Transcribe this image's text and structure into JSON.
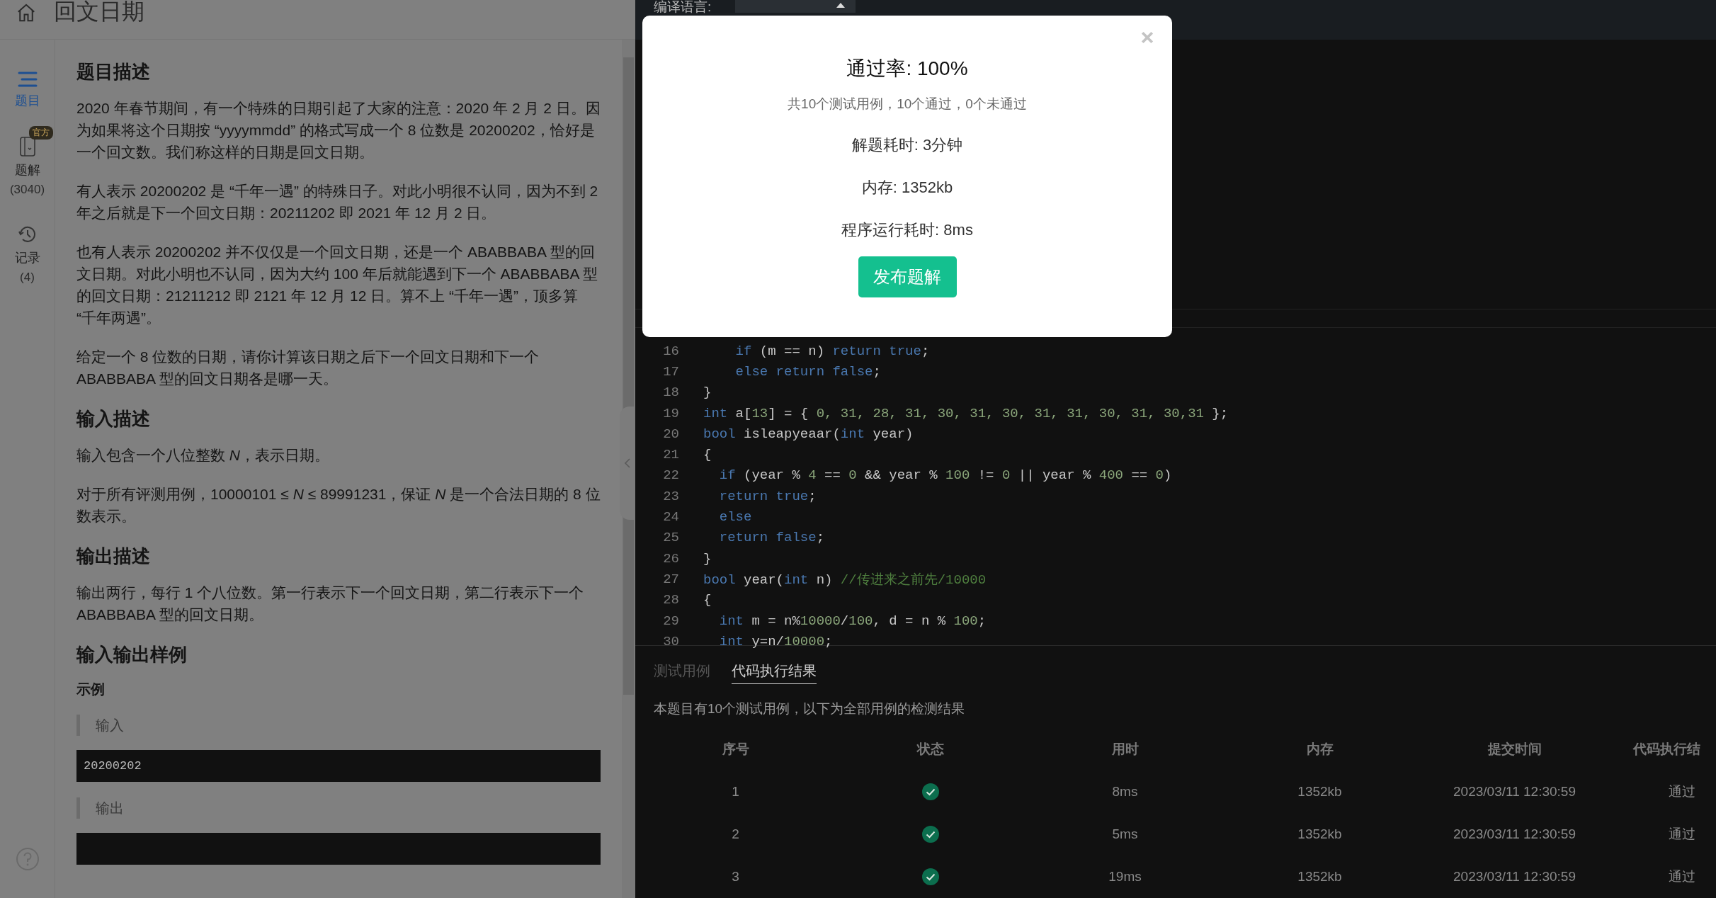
{
  "header": {
    "title": "回文日期"
  },
  "sidebar": {
    "items": [
      {
        "kind": "list",
        "label": "题目",
        "selected": true
      },
      {
        "kind": "book",
        "label": "题解",
        "badge": "官方",
        "count": "(3040)",
        "selected": false
      },
      {
        "kind": "history",
        "label": "记录",
        "count": "(4)",
        "selected": false
      }
    ]
  },
  "problem": {
    "sections": [
      {
        "heading": "题目描述",
        "paragraphs": [
          "2020 年春节期间，有一个特殊的日期引起了大家的注意：2020 年 2 月 2 日。因为如果将这个日期按 “yyyymmdd” 的格式写成一个 8 位数是 20200202，恰好是一个回文数。我们称这样的日期是回文日期。",
          "有人表示 20200202 是 “千年一遇” 的特殊日子。对此小明很不认同，因为不到 2 年之后就是下一个回文日期：20211202 即 2021 年 12 月 2 日。",
          "也有人表示 20200202 并不仅仅是一个回文日期，还是一个 ABABBABA 型的回文日期。对此小明也不认同，因为大约 100 年后就能遇到下一个 ABABBABA 型的回文日期：21211212 即 2121 年 12 月 12 日。算不上 “千年一遇”，顶多算 “千年两遇”。",
          "给定一个 8 位数的日期，请你计算该日期之后下一个回文日期和下一个 ABABBABA 型的回文日期各是哪一天。"
        ]
      },
      {
        "heading": "输入描述",
        "paragraphs": [
          "输入包含一个八位整数 *N*，表示日期。",
          "对于所有评测用例，10000101 ≤ *N* ≤ 89991231，保证 *N* 是一个合法日期的 8 位数表示。"
        ]
      },
      {
        "heading": "输出描述",
        "paragraphs": [
          "输出两行，每行 1 个八位数。第一行表示下一个回文日期，第二行表示下一个 ABABBABA 型的回文日期。"
        ]
      }
    ],
    "samples": {
      "heading": "输入输出样例",
      "example_title": "示例",
      "input_label": "输入",
      "input": "20200202",
      "output_label": "输出"
    }
  },
  "editor": {
    "language_label": "编译语言:",
    "lines": [
      {
        "number": "16",
        "tokens": [
          {
            "text": "    if",
            "kind": "keyword"
          },
          {
            "text": " (m == n)",
            "kind": "plain"
          },
          {
            "text": " return true",
            "kind": "keyword"
          },
          {
            "text": ";",
            "kind": "plain"
          }
        ]
      },
      {
        "number": "17",
        "tokens": [
          {
            "text": "    else return false",
            "kind": "keyword"
          },
          {
            "text": ";",
            "kind": "plain"
          }
        ]
      },
      {
        "number": "18",
        "tokens": [
          {
            "text": "}",
            "kind": "plain"
          }
        ]
      },
      {
        "number": "19",
        "tokens": [
          {
            "text": "int",
            "kind": "keyword"
          },
          {
            "text": " a[",
            "kind": "plain"
          },
          {
            "text": "13",
            "kind": "number"
          },
          {
            "text": "] = {",
            "kind": "plain"
          },
          {
            "text": " 0, 31, 28, 31, 30, 31, 30, 31, 31, 30, 31, 30,31",
            "kind": "number"
          },
          {
            "text": " };",
            "kind": "plain"
          }
        ]
      },
      {
        "number": "20",
        "tokens": [
          {
            "text": "bool",
            "kind": "keyword"
          },
          {
            "text": " isleapyeaar(",
            "kind": "plain"
          },
          {
            "text": "int",
            "kind": "keyword"
          },
          {
            "text": " year)",
            "kind": "plain"
          }
        ]
      },
      {
        "number": "21",
        "tokens": [
          {
            "text": "{",
            "kind": "plain"
          }
        ]
      },
      {
        "number": "22",
        "tokens": [
          {
            "text": "  if",
            "kind": "keyword"
          },
          {
            "text": " (year %",
            "kind": "plain"
          },
          {
            "text": " 4",
            "kind": "number"
          },
          {
            "text": " ==",
            "kind": "plain"
          },
          {
            "text": " 0",
            "kind": "number"
          },
          {
            "text": " && year %",
            "kind": "plain"
          },
          {
            "text": " 100",
            "kind": "number"
          },
          {
            "text": " !=",
            "kind": "plain"
          },
          {
            "text": " 0",
            "kind": "number"
          },
          {
            "text": " || year %",
            "kind": "plain"
          },
          {
            "text": " 400",
            "kind": "number"
          },
          {
            "text": " ==",
            "kind": "plain"
          },
          {
            "text": " 0",
            "kind": "number"
          },
          {
            "text": ")",
            "kind": "plain"
          }
        ]
      },
      {
        "number": "23",
        "tokens": [
          {
            "text": "  return true",
            "kind": "keyword"
          },
          {
            "text": ";",
            "kind": "plain"
          }
        ]
      },
      {
        "number": "24",
        "tokens": [
          {
            "text": "  else",
            "kind": "keyword"
          }
        ]
      },
      {
        "number": "25",
        "tokens": [
          {
            "text": "  return false",
            "kind": "keyword"
          },
          {
            "text": ";",
            "kind": "plain"
          }
        ]
      },
      {
        "number": "26",
        "tokens": [
          {
            "text": "}",
            "kind": "plain"
          }
        ]
      },
      {
        "number": "27",
        "tokens": [
          {
            "text": "bool",
            "kind": "keyword"
          },
          {
            "text": " year(",
            "kind": "plain"
          },
          {
            "text": "int",
            "kind": "keyword"
          },
          {
            "text": " n)",
            "kind": "plain"
          },
          {
            "text": " //传进来之前先/10000",
            "kind": "comment"
          }
        ]
      },
      {
        "number": "28",
        "tokens": [
          {
            "text": "{",
            "kind": "plain"
          }
        ]
      },
      {
        "number": "29",
        "tokens": [
          {
            "text": "  int",
            "kind": "keyword"
          },
          {
            "text": " m = n%",
            "kind": "plain"
          },
          {
            "text": "10000",
            "kind": "number"
          },
          {
            "text": "/",
            "kind": "plain"
          },
          {
            "text": "100",
            "kind": "number"
          },
          {
            "text": ", d = n %",
            "kind": "plain"
          },
          {
            "text": " 100",
            "kind": "number"
          },
          {
            "text": ";",
            "kind": "plain"
          }
        ]
      },
      {
        "number": "30",
        "tokens": [
          {
            "text": "  int",
            "kind": "keyword"
          },
          {
            "text": " y=n/",
            "kind": "plain"
          },
          {
            "text": "10000",
            "kind": "number"
          },
          {
            "text": ";",
            "kind": "plain"
          }
        ]
      }
    ]
  },
  "results": {
    "tabs": [
      {
        "label": "测试用例",
        "selected": false
      },
      {
        "label": "代码执行结果",
        "selected": true
      }
    ],
    "summary": "本题目有10个测试用例，以下为全部用例的检测结果",
    "columns": [
      "序号",
      "状态",
      "用时",
      "内存",
      "提交时间",
      "代码执行结"
    ],
    "rows": [
      {
        "index": "1",
        "passed": true,
        "time": "8ms",
        "memory": "1352kb",
        "submitted": "2023/03/11 12:30:59",
        "result": "通过"
      },
      {
        "index": "2",
        "passed": true,
        "time": "5ms",
        "memory": "1352kb",
        "submitted": "2023/03/11 12:30:59",
        "result": "通过"
      },
      {
        "index": "3",
        "passed": true,
        "time": "19ms",
        "memory": "1352kb",
        "submitted": "2023/03/11 12:30:59",
        "result": "通过"
      }
    ]
  },
  "dialog": {
    "title": "通过率: 100%",
    "subtitle": "共10个测试用例，10个通过，0个未通过",
    "stats": [
      "解题耗时: 3分钟",
      "内存: 1352kb",
      "程序运行耗时: 8ms"
    ],
    "button": "发布题解"
  }
}
